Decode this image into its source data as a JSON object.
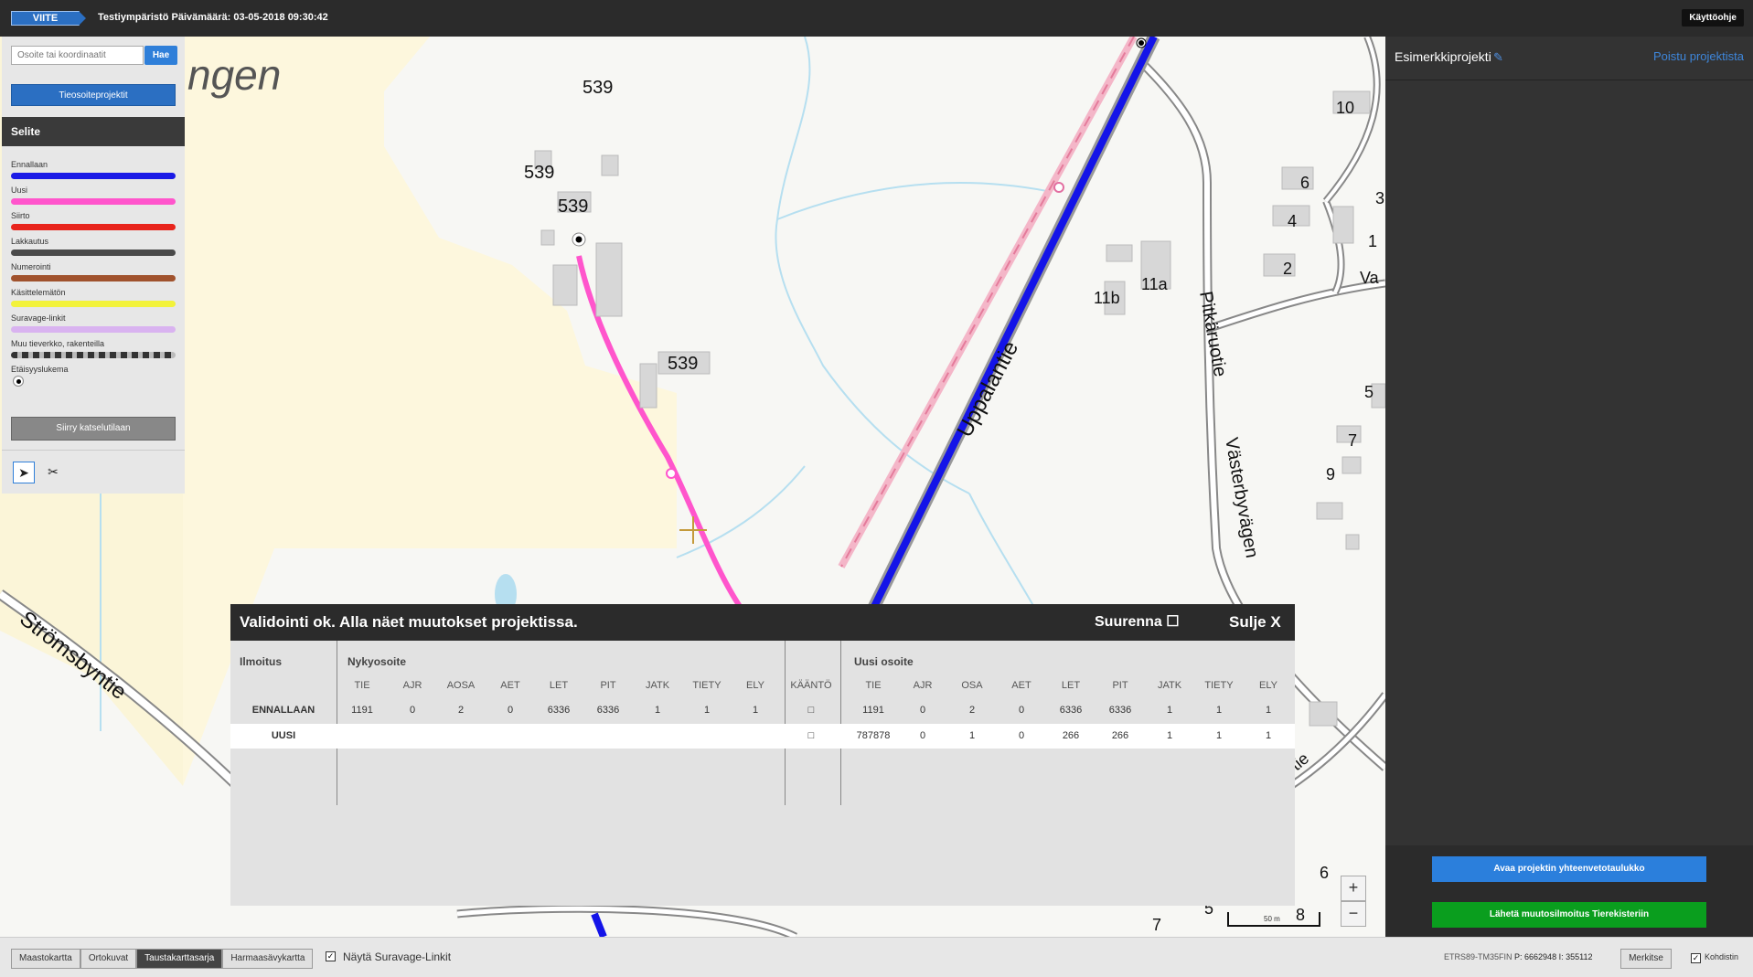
{
  "header": {
    "logo_text": "VIITE",
    "environment": "Testiympäristö Päivämäärä: 03-05-2018 09:30:42",
    "manual_label": "Käyttöohje"
  },
  "left_panel": {
    "search_placeholder": "Osoite tai koordinaatit",
    "search_button": "Hae",
    "projects_button": "Tieosoiteprojektit",
    "legend_title": "Selite",
    "legend": [
      {
        "label": "Ennallaan",
        "color": "#1a1ae6"
      },
      {
        "label": "Uusi",
        "color": "#ff55cc"
      },
      {
        "label": "Siirto",
        "color": "#e8241c"
      },
      {
        "label": "Lakkautus",
        "color": "#4a4a4a"
      },
      {
        "label": "Numerointi",
        "color": "#a0522d"
      },
      {
        "label": "Käsittelemätön",
        "color": "#f2f23a"
      },
      {
        "label": "Suravage-linkit",
        "color": "#d9b3f0"
      },
      {
        "label": "Muu tieverkko, rakenteilla",
        "color": "dashed"
      },
      {
        "label": "Etäisyyslukema",
        "color": "pin"
      }
    ],
    "view_mode_button": "Siirry katselutilaan",
    "tools": {
      "select": "select-arrow-icon",
      "cut": "scissors-icon"
    }
  },
  "right_panel": {
    "project_name": "Esimerkkiprojekti",
    "leave_project": "Poistu projektista",
    "summary_button": "Avaa projektin yhteenvetotaulukko",
    "send_button": "Lähetä muutosilmoitus Tierekisteriin"
  },
  "map": {
    "labels": [
      "ngen",
      "539",
      "539",
      "539",
      "539",
      "10",
      "6",
      "4",
      "2",
      "11a",
      "11b",
      "5",
      "7",
      "9",
      "1",
      "3",
      "8",
      "6",
      "7",
      "5",
      "Uppalantie",
      "Pitkäruotie",
      "Västerbyvägen",
      "Strömsbyntie",
      "Va",
      "tie"
    ],
    "scale_label": "50 m",
    "zoom_in": "+",
    "zoom_out": "−"
  },
  "modal": {
    "title": "Validointi ok. Alla näet muutokset projektissa.",
    "enlarge_label": "Suurenna",
    "close_label": "Sulje X",
    "section_notice": "Ilmoitus",
    "section_current": "Nykyosoite",
    "section_new": "Uusi osoite",
    "current_columns": [
      "TIE",
      "AJR",
      "AOSA",
      "AET",
      "LET",
      "PIT",
      "JATK",
      "TIETY",
      "ELY"
    ],
    "reverse_column": "KÄÄNTÖ",
    "new_columns": [
      "TIE",
      "AJR",
      "OSA",
      "AET",
      "LET",
      "PIT",
      "JATK",
      "TIETY",
      "ELY"
    ],
    "rows": [
      {
        "notice": "ENNALLAAN",
        "current": [
          "1191",
          "0",
          "2",
          "0",
          "6336",
          "6336",
          "1",
          "1",
          "1"
        ],
        "reverse": "□",
        "new": [
          "1191",
          "0",
          "2",
          "0",
          "6336",
          "6336",
          "1",
          "1",
          "1"
        ]
      },
      {
        "notice": "UUSI",
        "current": [
          "",
          "",
          "",
          "",
          "",
          "",
          "",
          "",
          ""
        ],
        "reverse": "□",
        "new": [
          "787878",
          "0",
          "1",
          "0",
          "266",
          "266",
          "1",
          "1",
          "1"
        ]
      }
    ]
  },
  "bottom_bar": {
    "basemaps": [
      "Maastokartta",
      "Ortokuvat",
      "Taustakarttasarja",
      "Harmaasävykartta"
    ],
    "active_basemap": "Taustakarttasarja",
    "suravage_label": "Näytä Suravage-Linkit",
    "suravage_checked": "✓",
    "coordinates": "ETRS89-TM35FIN",
    "coord_p": "P: 6662948",
    "coord_i": "I: 355112",
    "mark_button": "Merkitse",
    "center_label": "Kohdistin",
    "center_checked": "✓"
  }
}
